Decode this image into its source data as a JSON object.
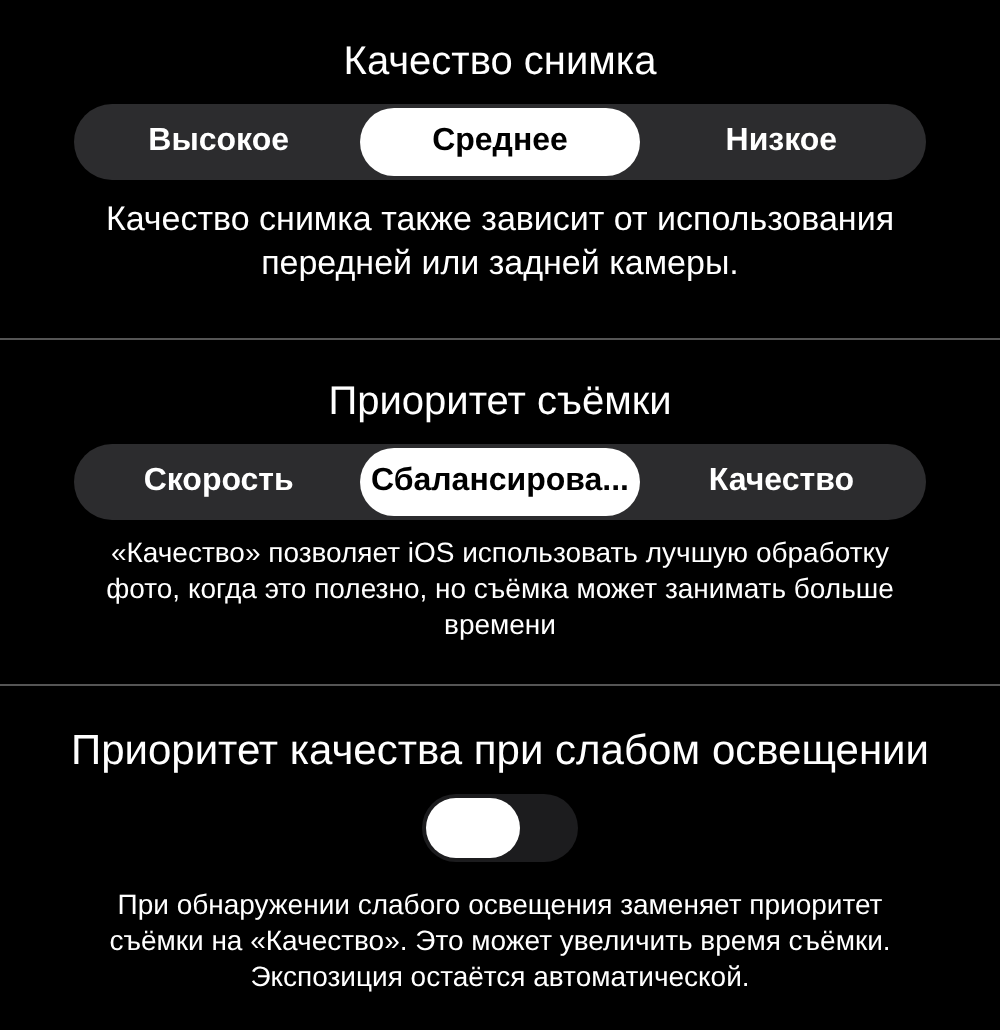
{
  "sections": [
    {
      "kind": "segmented",
      "title": "Качество снимка",
      "options": [
        {
          "label": "Высокое",
          "selected": false
        },
        {
          "label": "Среднее",
          "selected": true
        },
        {
          "label": "Низкое",
          "selected": false
        }
      ],
      "description": "Качество снимка также зависит от использования передней или задней камеры."
    },
    {
      "kind": "segmented",
      "title": "Приоритет съёмки",
      "options": [
        {
          "label": "Скорость",
          "selected": false
        },
        {
          "label": "Сбалансирова...",
          "selected": true
        },
        {
          "label": "Качество",
          "selected": false
        }
      ],
      "description": "«Качество» позволяет iOS использовать лучшую обработку фото, когда это полезно, но съёмка может занимать больше времени"
    },
    {
      "kind": "toggle",
      "title": "Приоритет качества при слабом освещении",
      "on": false,
      "description": "При обнаружении слабого освещения заменяет приоритет съёмки на «Качество». Это может увеличить время съёмки. Экспозиция остаётся автоматической."
    }
  ]
}
